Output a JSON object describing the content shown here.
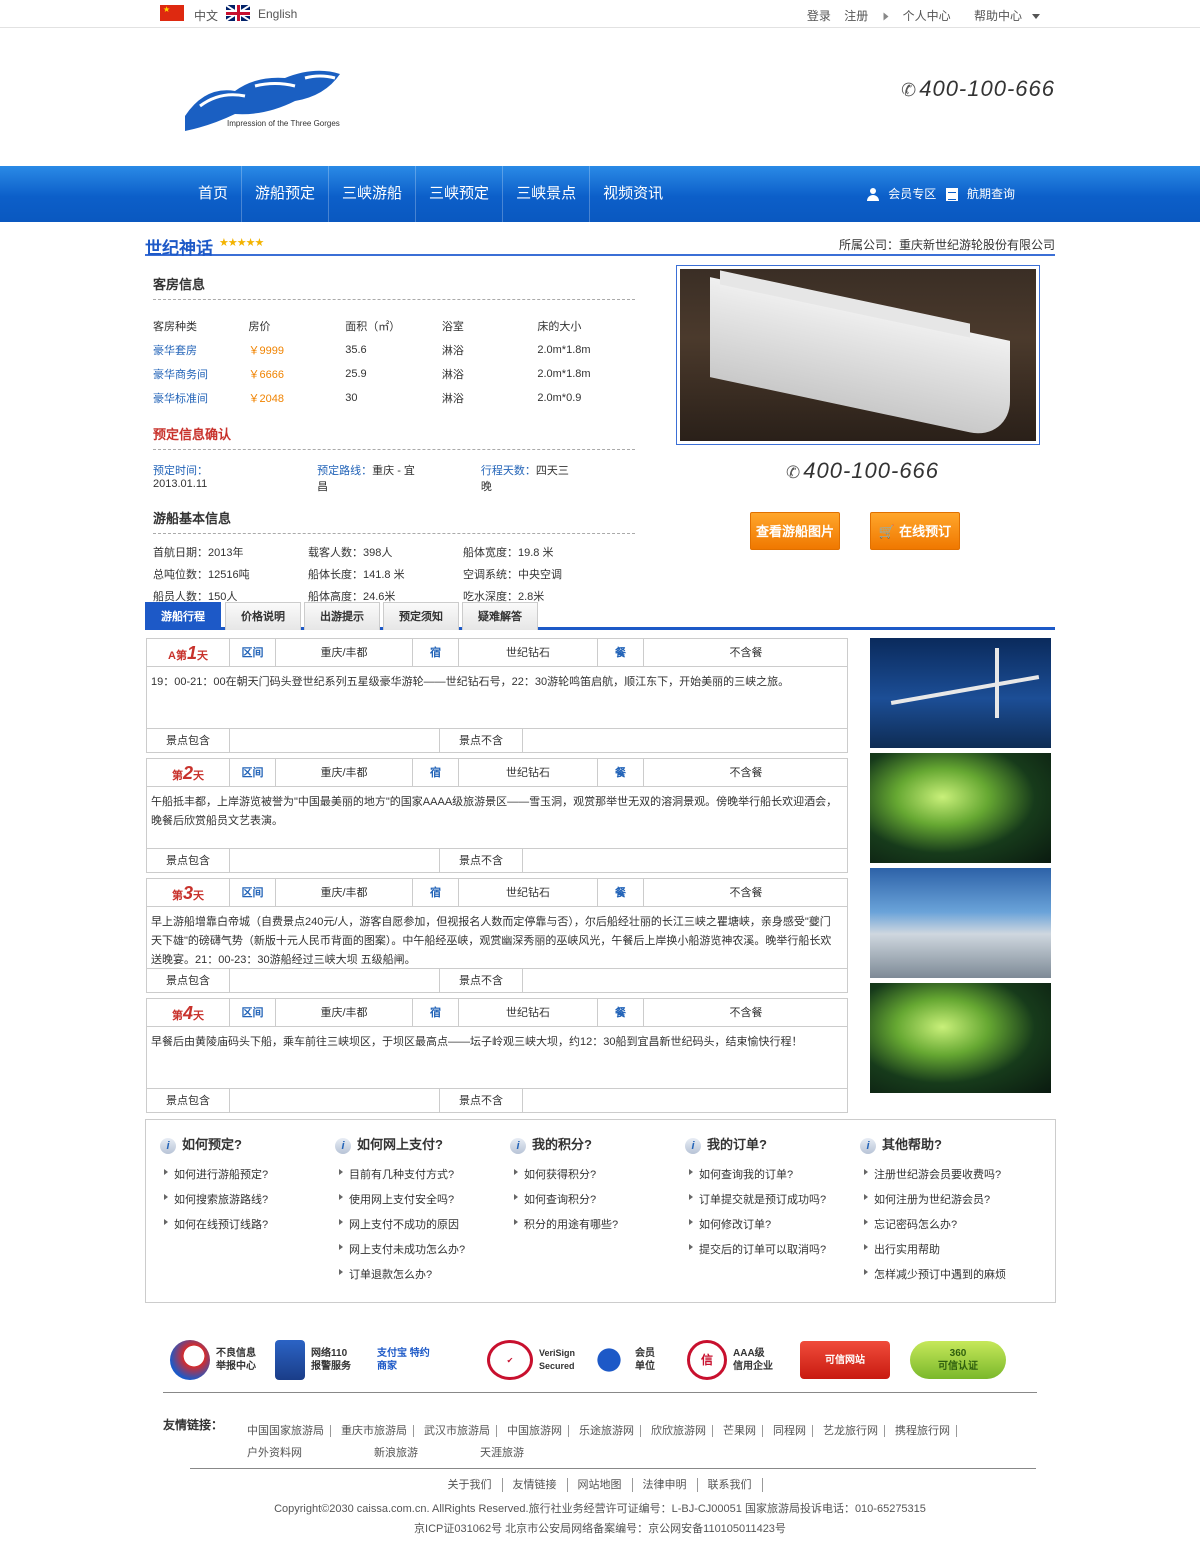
{
  "topbar": {
    "lang_cn": "中文",
    "lang_en": "English",
    "login": "登录",
    "register": "注册",
    "personal": "个人中心",
    "help": "帮助中心"
  },
  "header": {
    "logo_sub": "Impression of the Three Gorges",
    "phone": "400-100-666"
  },
  "nav": {
    "items": [
      "首页",
      "游船预定",
      "三峡游船",
      "三峡预定",
      "三峡景点",
      "视频资讯"
    ],
    "member": "会员专区",
    "schedule": "航期查询"
  },
  "ship": {
    "name": "世纪神话",
    "stars": "★★★★★",
    "company": "所属公司：重庆新世纪游轮股份有限公司"
  },
  "rooms": {
    "title": "客房信息",
    "headers": [
      "客房种类",
      "房价",
      "面积（㎡）",
      "浴室",
      "床的大小"
    ],
    "rows": [
      [
        "豪华套房",
        "￥9999",
        "35.6",
        "淋浴",
        "2.0m*1.8m"
      ],
      [
        "豪华商务间",
        "￥6666",
        "25.9",
        "淋浴",
        "2.0m*1.8m"
      ],
      [
        "豪华标准间",
        "￥2048",
        "30",
        "淋浴",
        "2.0m*0.9"
      ]
    ]
  },
  "booking": {
    "title": "预定信息确认",
    "time_label": "预定时间：",
    "time": "2013.01.11",
    "route_label": "预定路线：",
    "route": "重庆 - 宜昌",
    "days_label": "行程天数：",
    "days": "四天三晚"
  },
  "basic": {
    "title": "游船基本信息",
    "items": [
      [
        "首航日期：",
        "2013年"
      ],
      [
        "载客人数：",
        "398人"
      ],
      [
        "船体宽度：",
        "19.8 米"
      ],
      [
        "总吨位数：",
        "12516吨"
      ],
      [
        "船体长度：",
        "141.8 米"
      ],
      [
        "空调系统：",
        "中央空调"
      ],
      [
        "船员人数：",
        "150人"
      ],
      [
        "船体高度：",
        "24.6米"
      ],
      [
        "吃水深度：",
        "2.8米"
      ]
    ]
  },
  "right": {
    "phone": "400-100-666",
    "btn_pics": "查看游船图片",
    "btn_book": "在线预订"
  },
  "tabs": [
    "游船行程",
    "价格说明",
    "出游提示",
    "预定须知",
    "疑难解答"
  ],
  "days": [
    {
      "prefix": "A第",
      "num": "1",
      "suffix": "天",
      "zone_label": "区间",
      "zone": "重庆/丰都",
      "stay_label": "宿",
      "stay": "世纪钻石",
      "meal_label": "餐",
      "meal": "不含餐",
      "desc": "19：00-21：00在朝天门码头登世纪系列五星级豪华游轮——世纪钻石号，22：30游轮鸣笛启航，顺江东下，开始美丽的三峡之旅。",
      "incl": "景点包含",
      "excl": "景点不含"
    },
    {
      "prefix": "第",
      "num": "2",
      "suffix": "天",
      "zone_label": "区间",
      "zone": "重庆/丰都",
      "stay_label": "宿",
      "stay": "世纪钻石",
      "meal_label": "餐",
      "meal": "不含餐",
      "desc": "午船抵丰都，上岸游览被誉为\"中国最美丽的地方\"的国家AAAA级旅游景区——雪玉洞，观赏那举世无双的溶洞景观。傍晚举行船长欢迎酒会，晚餐后欣赏船员文艺表演。",
      "incl": "景点包含",
      "excl": "景点不含"
    },
    {
      "prefix": "第",
      "num": "3",
      "suffix": "天",
      "zone_label": "区间",
      "zone": "重庆/丰都",
      "stay_label": "宿",
      "stay": "世纪钻石",
      "meal_label": "餐",
      "meal": "不含餐",
      "desc": "早上游船增靠白帝城（自费景点240元/人，游客自愿参加，但视报名人数而定停靠与否），尔后船经壮丽的长江三峡之瞿塘峡，亲身感受\"夔门天下雄\"的磅礴气势（新版十元人民币背面的图案）。中午船经巫峡，观赏幽深秀丽的巫峡风光，午餐后上岸换小船游览神农溪。晚举行船长欢送晚宴。21：00-23：30游船经过三峡大坝 五级船闸。",
      "incl": "景点包含",
      "excl": "景点不含"
    },
    {
      "prefix": "第",
      "num": "4",
      "suffix": "天",
      "zone_label": "区间",
      "zone": "重庆/丰都",
      "stay_label": "宿",
      "stay": "世纪钻石",
      "meal_label": "餐",
      "meal": "不含餐",
      "desc": "早餐后由黄陵庙码头下船，乘车前往三峡坝区，于坝区最高点——坛子岭观三峡大坝，约12：30船到宜昌新世纪码头，结束愉快行程！",
      "incl": "景点包含",
      "excl": "景点不含"
    }
  ],
  "help": [
    {
      "title": "如何预定?",
      "items": [
        "如何进行游船预定?",
        "如何搜索旅游路线?",
        "如何在线预订线路?"
      ]
    },
    {
      "title": "如何网上支付?",
      "items": [
        "目前有几种支付方式?",
        "使用网上支付安全吗?",
        "网上支付不成功的原因",
        "网上支付未成功怎么办?",
        "订单退款怎么办?"
      ]
    },
    {
      "title": "我的积分?",
      "items": [
        "如何获得积分?",
        "如何查询积分?",
        "积分的用途有哪些?"
      ]
    },
    {
      "title": "我的订单?",
      "items": [
        "如何查询我的订单?",
        "订单提交就是预订成功吗?",
        "如何修改订单?",
        "提交后的订单可以取消吗?"
      ]
    },
    {
      "title": "其他帮助?",
      "items": [
        "注册世纪游会员要收费吗?",
        "如何注册为世纪游会员?",
        "忘记密码怎么办?",
        "出行实用帮助",
        "怎样减少预订中遇到的麻烦"
      ]
    }
  ],
  "badges": [
    "不良信息\n举报中心",
    "网络110\n报警服务",
    "支付宝 特约\n商家",
    "VeriSign\nSecured",
    "会员\n单位",
    "AAA级\n信用企业",
    "可信网站",
    "360\n可信认证"
  ],
  "friend_links": {
    "label": "友情链接：",
    "items": [
      "中国国家旅游局",
      "重庆市旅游局",
      "武汉市旅游局",
      "中国旅游网",
      "乐途旅游网",
      "欣欣旅游网",
      "芒果网",
      "同程网",
      "艺龙旅行网",
      "携程旅行网",
      "户外资料网",
      "新浪旅游",
      "天涯旅游"
    ]
  },
  "footer": {
    "links": [
      "关于我们",
      "友情链接",
      "网站地图",
      "法律申明",
      "联系我们"
    ],
    "copyright": "Copyright©2030 caissa.com.cn. AllRights Reserved.旅行社业务经营许可证编号：L-BJ-CJ00051 国家旅游局投诉电话：010-65275315",
    "icp": "京ICP证031062号 北京市公安局网络备案编号：京公网安备110105011423号"
  },
  "colors": {
    "accent": "#1d59c7",
    "price": "#f08300",
    "button": "#f58b10",
    "day_red": "#c8322c"
  }
}
